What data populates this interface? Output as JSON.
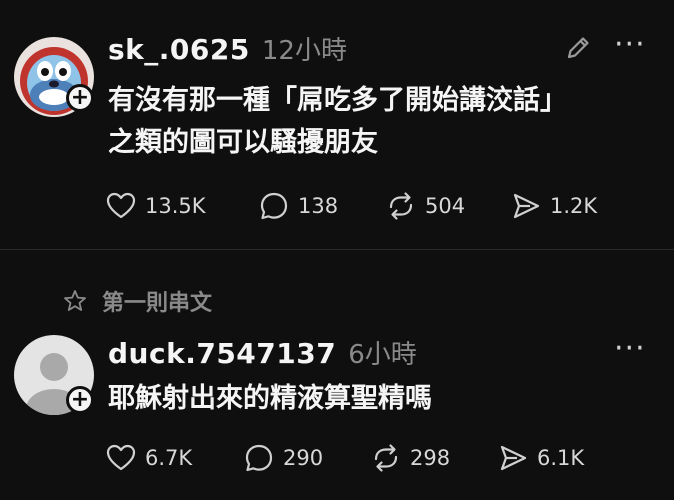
{
  "posts": [
    {
      "username": "sk_.0625",
      "time": "12小時",
      "text_lines": [
        "有沒有那一種「屌吃多了開始講洨話」",
        "之類的圖可以騷擾朋友"
      ],
      "actions": {
        "likes": "13.5K",
        "comments": "138",
        "reposts": "504",
        "shares": "1.2K"
      },
      "avatar_icon": "blue-mascot-avatar",
      "has_edit_icon": true
    },
    {
      "username": "duck.7547137",
      "time": "6小時",
      "text_lines": [
        "耶穌射出來的精液算聖精嗎"
      ],
      "actions": {
        "likes": "6.7K",
        "comments": "290",
        "reposts": "298",
        "shares": "6.1K"
      },
      "avatar_icon": "default-user-avatar",
      "has_edit_icon": false
    }
  ],
  "thread_label": "第一則串文",
  "icons": {
    "like": "heart-icon",
    "comment": "comment-bubble-icon",
    "repost": "repost-icon",
    "share": "send-icon",
    "edit": "pencil-icon",
    "more": "more-dots-icon",
    "thread": "star-icon",
    "follow": "plus-icon"
  },
  "colors": {
    "background": "#0f0f0f",
    "text_primary": "#f5f5f5",
    "text_secondary": "#8a8a8a"
  }
}
